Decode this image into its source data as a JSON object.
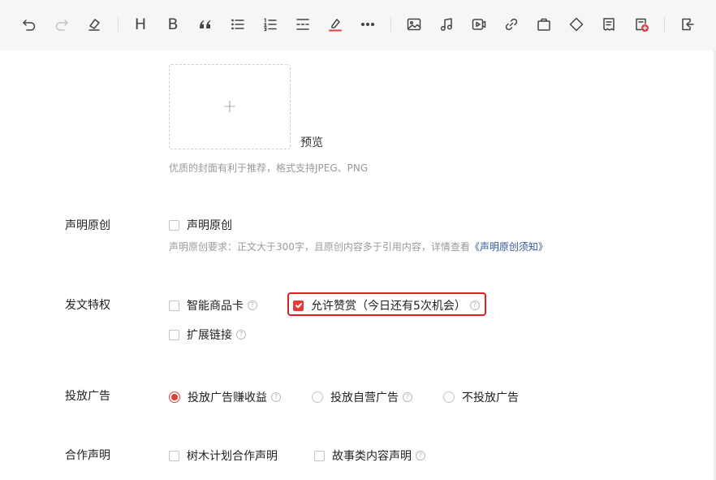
{
  "toolbar": {
    "heading_letter": "H",
    "bold_letter": "B",
    "items": [
      {
        "name": "undo-icon",
        "enabled": true
      },
      {
        "name": "redo-icon",
        "enabled": false
      },
      {
        "name": "eraser-icon",
        "enabled": true
      },
      {
        "name": "heading-icon",
        "enabled": true
      },
      {
        "name": "bold-icon",
        "enabled": true
      },
      {
        "name": "quote-icon",
        "enabled": true
      },
      {
        "name": "bullet-list-icon",
        "enabled": true
      },
      {
        "name": "numbered-list-icon",
        "enabled": true
      },
      {
        "name": "divider-icon",
        "enabled": true
      },
      {
        "name": "highlight-color-icon",
        "enabled": true
      },
      {
        "name": "more-icon",
        "enabled": true
      },
      {
        "name": "image-icon",
        "enabled": true
      },
      {
        "name": "music-icon",
        "enabled": true
      },
      {
        "name": "video-icon",
        "enabled": true
      },
      {
        "name": "link-icon",
        "enabled": true
      },
      {
        "name": "product-bag-icon",
        "enabled": true
      },
      {
        "name": "diamond-icon",
        "enabled": true
      },
      {
        "name": "note-icon",
        "enabled": true
      },
      {
        "name": "insert-card-icon",
        "enabled": true
      },
      {
        "name": "export-icon",
        "enabled": true
      }
    ],
    "colors": {
      "icon": "#444444",
      "disabled": "#c4c4c4",
      "highlight_underline": "#e83a3a",
      "card_badge": "#e83a3a"
    }
  },
  "cover": {
    "plus": "+",
    "preview_label": "预览",
    "hint": "优质的封面有利于推荐，格式支持JPEG、PNG"
  },
  "originality": {
    "label": "声明原创",
    "checkbox_label": "声明原创",
    "checked": false,
    "hint_prefix": "声明原创要求：正文大于300字，且原创内容多于引用内容，详情查看",
    "hint_link": "《声明原创须知》"
  },
  "privileges": {
    "label": "发文特权",
    "options": [
      {
        "label": "智能商品卡",
        "checked": false,
        "help": "?"
      },
      {
        "label": "允许赞赏（今日还有5次机会）",
        "checked": true,
        "help": "?"
      },
      {
        "label": "扩展链接",
        "checked": false,
        "help": "?"
      }
    ]
  },
  "ads": {
    "label": "投放广告",
    "options": [
      {
        "label": "投放广告赚收益",
        "selected": true,
        "help": "?"
      },
      {
        "label": "投放自营广告",
        "selected": false,
        "help": "?"
      },
      {
        "label": "不投放广告",
        "selected": false
      }
    ]
  },
  "cooperation": {
    "label": "合作声明",
    "options": [
      {
        "label": "树木计划合作声明",
        "checked": false
      },
      {
        "label": "故事类内容声明",
        "checked": false,
        "help": "?"
      }
    ]
  },
  "colors": {
    "accent": "#e83a3a",
    "annotation_box": "#e02020",
    "link": "#2f5597"
  }
}
